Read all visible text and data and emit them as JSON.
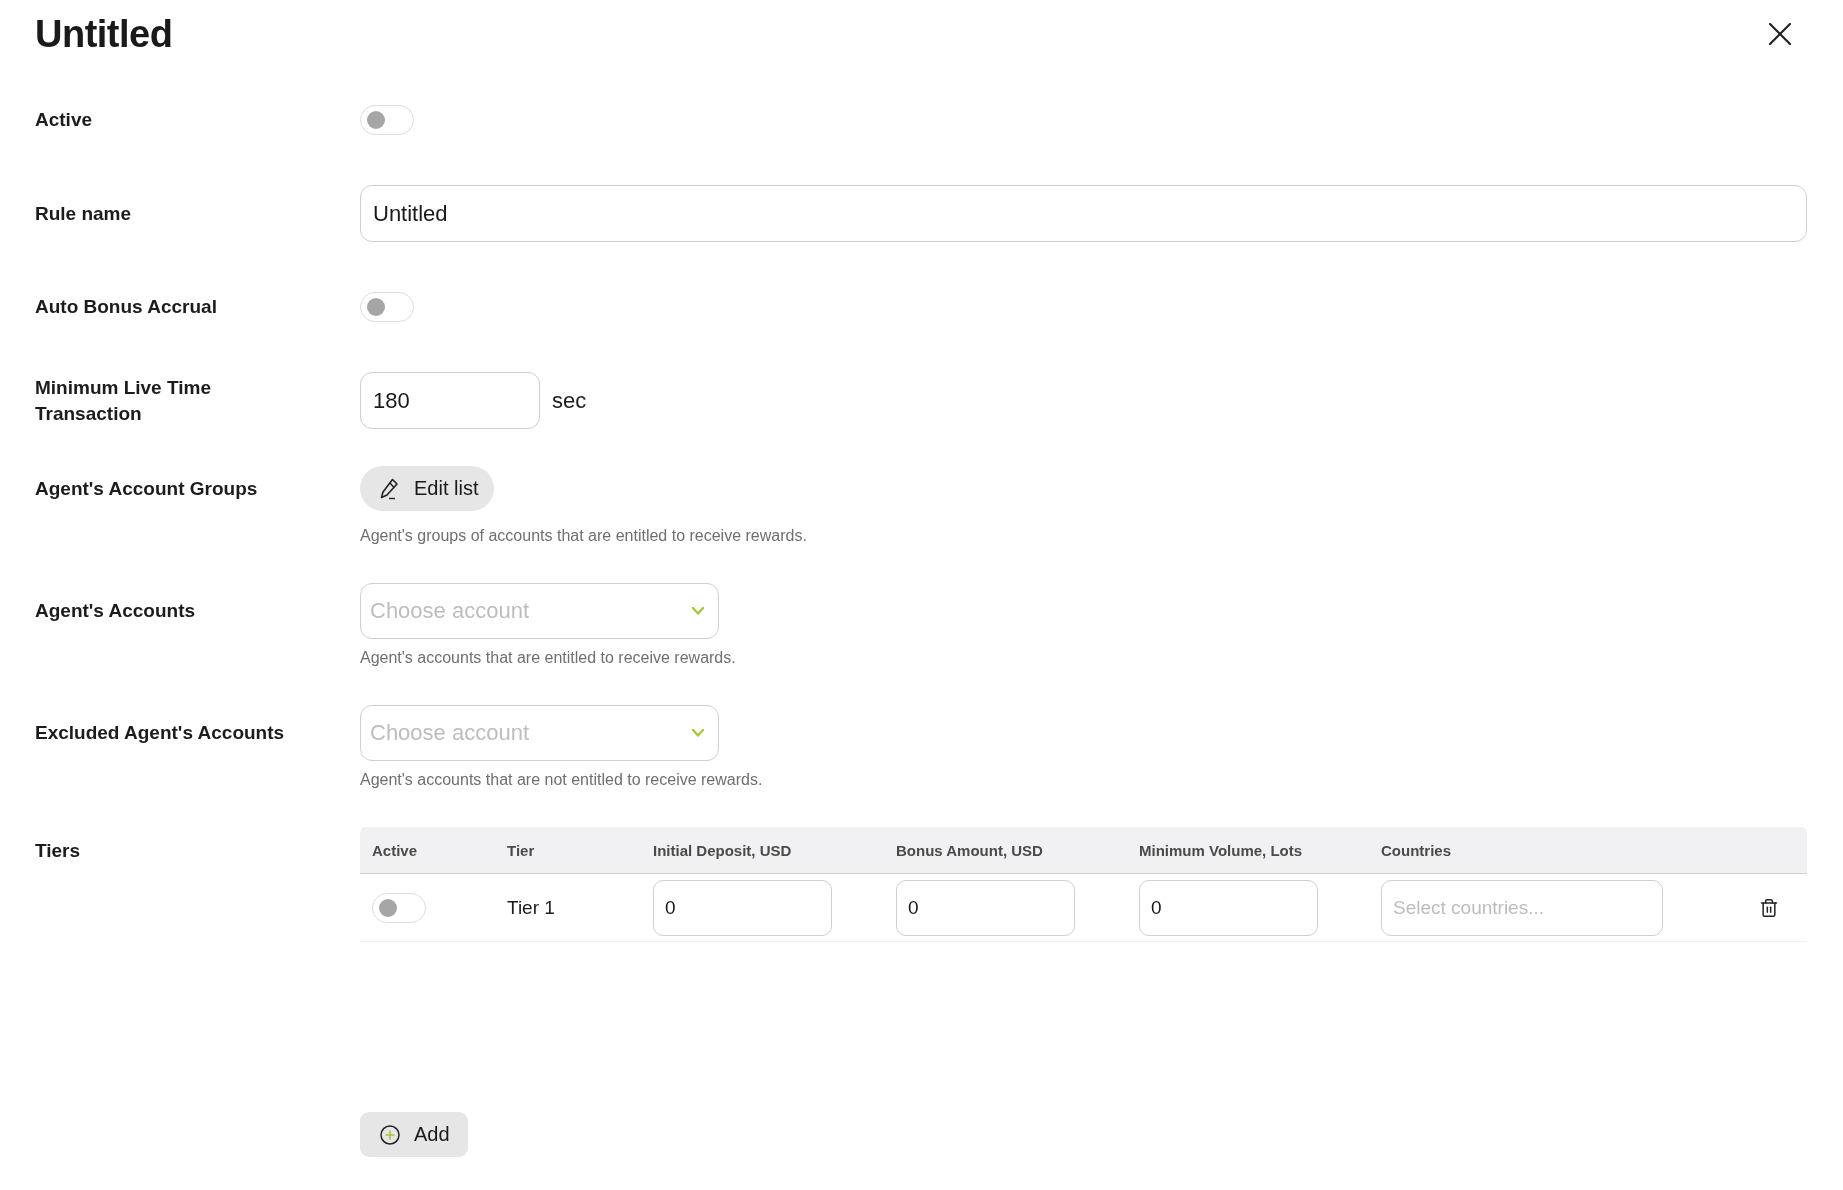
{
  "dialog": {
    "title": "Untitled"
  },
  "fields": [
    {
      "kind": "toggle",
      "label": "Active",
      "on": false
    },
    {
      "kind": "text",
      "label": "Rule name",
      "value": "Untitled"
    },
    {
      "kind": "toggle",
      "label": "Auto Bonus Accrual",
      "on": false
    },
    {
      "kind": "number",
      "label": "Minimum Live Time Transaction",
      "value": "180",
      "unit": "sec"
    },
    {
      "kind": "button",
      "label": "Agent's Account Groups",
      "button": "Edit list",
      "hint": "Agent's groups of accounts that are entitled to receive rewards."
    },
    {
      "kind": "select",
      "label": "Agent's Accounts",
      "placeholder": "Choose account",
      "hint": "Agent's accounts that are entitled to receive rewards."
    },
    {
      "kind": "select",
      "label": "Excluded Agent's Accounts",
      "placeholder": "Choose account",
      "hint": "Agent's accounts that are not entitled to receive rewards."
    }
  ],
  "tiers": {
    "label": "Tiers",
    "columns": [
      "Active",
      "Tier",
      "Initial Deposit, USD",
      "Bonus Amount, USD",
      "Minimum Volume, Lots",
      "Countries"
    ],
    "rows": [
      {
        "on": false,
        "tier": "Tier 1",
        "initial_deposit": "0",
        "bonus_amount": "0",
        "minimum_volume": "0",
        "countries_placeholder": "Select countries..."
      }
    ]
  },
  "add_button": "Add"
}
